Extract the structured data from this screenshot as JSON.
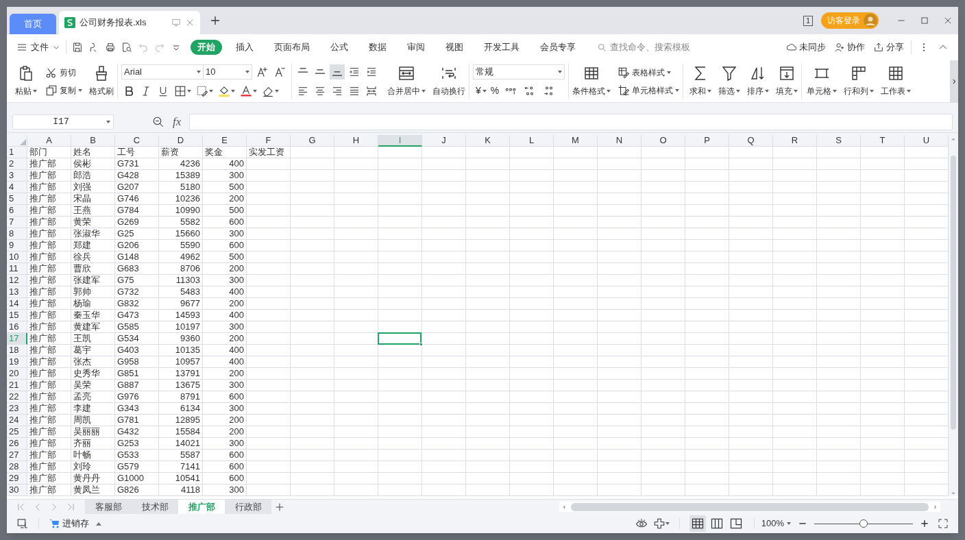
{
  "tabs": [
    {
      "label": "首页",
      "kind": "home",
      "selected": false
    },
    {
      "label": "公司财务报表.xls",
      "kind": "document",
      "selected": true
    }
  ],
  "window_count": "1",
  "login_button": "访客登录",
  "file_menu": "文件",
  "ribbon_tabs": [
    {
      "label": "开始",
      "selected": true
    },
    {
      "label": "插入",
      "selected": false
    },
    {
      "label": "页面布局",
      "selected": false
    },
    {
      "label": "公式",
      "selected": false
    },
    {
      "label": "数据",
      "selected": false
    },
    {
      "label": "审阅",
      "selected": false
    },
    {
      "label": "视图",
      "selected": false
    },
    {
      "label": "开发工具",
      "selected": false
    },
    {
      "label": "会员专享",
      "selected": false
    }
  ],
  "search": {
    "placeholder": "查找命令、搜索模板"
  },
  "header_actions": [
    "未同步",
    "协作",
    "分享"
  ],
  "ribbon": {
    "paste": "粘贴",
    "cut": "剪切",
    "copy": "复制",
    "format_painter": "格式刷",
    "font": "Arial",
    "font_size": "10",
    "align_buttons": [
      {
        "kind": "top",
        "selected": false
      },
      {
        "kind": "middle",
        "selected": false
      },
      {
        "kind": "bottom",
        "selected": true
      }
    ],
    "merge": "合并居中",
    "wrap": "自动换行",
    "number_format": "常规",
    "currency": "¥",
    "percent": "%",
    "conditional_format": "条件格式",
    "table_style": "表格样式",
    "cell_style": "单元格样式",
    "sum": "求和",
    "filter": "筛选",
    "sort": "排序",
    "fill": "填充",
    "cell": "单元格",
    "rows_cols": "行和列",
    "worksheet": "工作表"
  },
  "name_box": "I17",
  "formula_label": "fx",
  "columns": [
    {
      "letter": "A",
      "numeric": false,
      "selected": false
    },
    {
      "letter": "B",
      "numeric": false,
      "selected": false
    },
    {
      "letter": "C",
      "numeric": false,
      "selected": false
    },
    {
      "letter": "D",
      "numeric": true,
      "selected": false
    },
    {
      "letter": "E",
      "numeric": true,
      "selected": false
    },
    {
      "letter": "F",
      "selected": false
    },
    {
      "letter": "G",
      "selected": false
    },
    {
      "letter": "H",
      "selected": false
    },
    {
      "letter": "I",
      "selected": true
    },
    {
      "letter": "J",
      "selected": false
    },
    {
      "letter": "K",
      "selected": false
    },
    {
      "letter": "L",
      "selected": false
    },
    {
      "letter": "M",
      "selected": false
    },
    {
      "letter": "N",
      "selected": false
    },
    {
      "letter": "O",
      "selected": false
    },
    {
      "letter": "P",
      "selected": false
    },
    {
      "letter": "Q",
      "selected": false
    },
    {
      "letter": "R",
      "selected": false
    },
    {
      "letter": "S",
      "selected": false
    },
    {
      "letter": "T",
      "selected": false
    },
    {
      "letter": "U",
      "selected": false
    }
  ],
  "rows": [
    {
      "number": "1",
      "kind": "header",
      "selected": false,
      "cells": [
        "部门",
        "姓名",
        "工号",
        "薪资",
        "奖金",
        "实发工资"
      ]
    },
    {
      "number": "2",
      "kind": "data",
      "selected": false,
      "cells": [
        "推广部",
        "侯彬",
        "G731",
        "4236",
        "400"
      ]
    },
    {
      "number": "3",
      "kind": "data",
      "selected": false,
      "cells": [
        "推广部",
        "郎浩",
        "G428",
        "15389",
        "300"
      ]
    },
    {
      "number": "4",
      "kind": "data",
      "selected": false,
      "cells": [
        "推广部",
        "刘强",
        "G207",
        "5180",
        "500"
      ]
    },
    {
      "number": "5",
      "kind": "data",
      "selected": false,
      "cells": [
        "推广部",
        "宋晶",
        "G746",
        "10236",
        "200"
      ]
    },
    {
      "number": "6",
      "kind": "data",
      "selected": false,
      "cells": [
        "推广部",
        "王燕",
        "G784",
        "10990",
        "500"
      ]
    },
    {
      "number": "7",
      "kind": "data",
      "selected": false,
      "cells": [
        "推广部",
        "黄荣",
        "G269",
        "5582",
        "600"
      ]
    },
    {
      "number": "8",
      "kind": "data",
      "selected": false,
      "cells": [
        "推广部",
        "张淑华",
        "G25",
        "15660",
        "300"
      ]
    },
    {
      "number": "9",
      "kind": "data",
      "selected": false,
      "cells": [
        "推广部",
        "郑建",
        "G206",
        "5590",
        "600"
      ]
    },
    {
      "number": "10",
      "kind": "data",
      "selected": false,
      "cells": [
        "推广部",
        "徐兵",
        "G148",
        "4962",
        "500"
      ]
    },
    {
      "number": "11",
      "kind": "data",
      "selected": false,
      "cells": [
        "推广部",
        "曹欣",
        "G683",
        "8706",
        "200"
      ]
    },
    {
      "number": "12",
      "kind": "data",
      "selected": false,
      "cells": [
        "推广部",
        "张建军",
        "G75",
        "11303",
        "300"
      ]
    },
    {
      "number": "13",
      "kind": "data",
      "selected": false,
      "cells": [
        "推广部",
        "郭帅",
        "G732",
        "5483",
        "400"
      ]
    },
    {
      "number": "14",
      "kind": "data",
      "selected": false,
      "cells": [
        "推广部",
        "杨瑜",
        "G832",
        "9677",
        "200"
      ]
    },
    {
      "number": "15",
      "kind": "data",
      "selected": false,
      "cells": [
        "推广部",
        "秦玉华",
        "G473",
        "14593",
        "400"
      ]
    },
    {
      "number": "16",
      "kind": "data",
      "selected": false,
      "cells": [
        "推广部",
        "黄建军",
        "G585",
        "10197",
        "300"
      ]
    },
    {
      "number": "17",
      "kind": "data",
      "selected": true,
      "cells": [
        "推广部",
        "王凯",
        "G534",
        "9360",
        "200"
      ]
    },
    {
      "number": "18",
      "kind": "data",
      "selected": false,
      "cells": [
        "推广部",
        "葛宇",
        "G403",
        "10135",
        "400"
      ]
    },
    {
      "number": "19",
      "kind": "data",
      "selected": false,
      "cells": [
        "推广部",
        "张杰",
        "G958",
        "10957",
        "400"
      ]
    },
    {
      "number": "20",
      "kind": "data",
      "selected": false,
      "cells": [
        "推广部",
        "史秀华",
        "G851",
        "13791",
        "200"
      ]
    },
    {
      "number": "21",
      "kind": "data",
      "selected": false,
      "cells": [
        "推广部",
        "吴荣",
        "G887",
        "13675",
        "300"
      ]
    },
    {
      "number": "22",
      "kind": "data",
      "selected": false,
      "cells": [
        "推广部",
        "孟亮",
        "G976",
        "8791",
        "600"
      ]
    },
    {
      "number": "23",
      "kind": "data",
      "selected": false,
      "cells": [
        "推广部",
        "李建",
        "G343",
        "6134",
        "300"
      ]
    },
    {
      "number": "24",
      "kind": "data",
      "selected": false,
      "cells": [
        "推广部",
        "周凯",
        "G781",
        "12895",
        "200"
      ]
    },
    {
      "number": "25",
      "kind": "data",
      "selected": false,
      "cells": [
        "推广部",
        "吴丽丽",
        "G432",
        "15584",
        "200"
      ]
    },
    {
      "number": "26",
      "kind": "data",
      "selected": false,
      "cells": [
        "推广部",
        "齐丽",
        "G253",
        "14021",
        "300"
      ]
    },
    {
      "number": "27",
      "kind": "data",
      "selected": false,
      "cells": [
        "推广部",
        "叶畅",
        "G533",
        "5587",
        "600"
      ]
    },
    {
      "number": "28",
      "kind": "data",
      "selected": false,
      "cells": [
        "推广部",
        "刘玲",
        "G579",
        "7141",
        "600"
      ]
    },
    {
      "number": "29",
      "kind": "data",
      "selected": false,
      "cells": [
        "推广部",
        "黄丹丹",
        "G1000",
        "10541",
        "600"
      ]
    },
    {
      "number": "30",
      "kind": "data",
      "selected": false,
      "cells": [
        "推广部",
        "黄凤兰",
        "G826",
        "4118",
        "300"
      ]
    }
  ],
  "sheet_tabs": [
    {
      "label": "客服部",
      "selected": false
    },
    {
      "label": "技术部",
      "selected": false
    },
    {
      "label": "推广部",
      "selected": true
    },
    {
      "label": "行政部",
      "selected": false
    }
  ],
  "status_bar": {
    "app": "进销存",
    "view_modes": [
      {
        "kind": "normal",
        "selected": true
      },
      {
        "kind": "reading",
        "selected": false
      },
      {
        "kind": "page",
        "selected": false
      }
    ],
    "zoom": "100%",
    "zoom_slider": {
      "level": 0.5
    }
  }
}
